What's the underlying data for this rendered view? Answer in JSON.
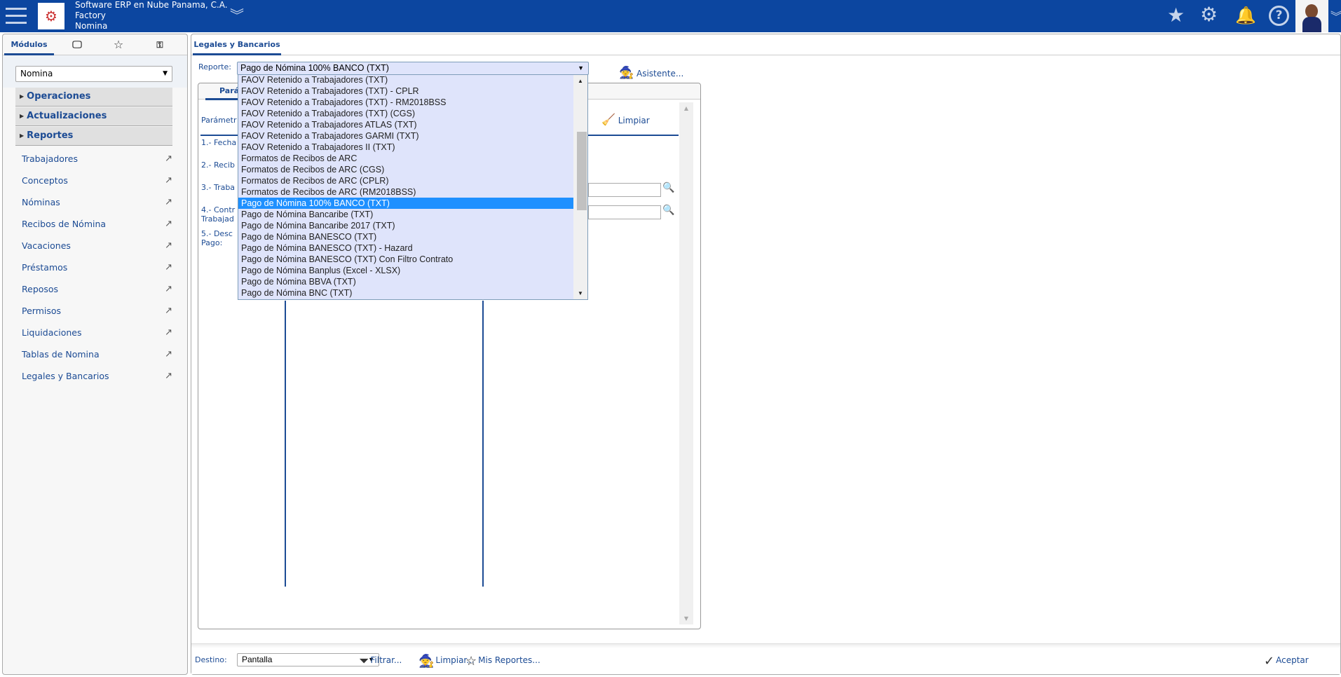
{
  "header": {
    "company": "Software ERP en Nube Panama, C.A.",
    "subtitle": "Factory",
    "module": "Nomina"
  },
  "sidebar": {
    "tabs": [
      {
        "label": "Módulos"
      },
      {
        "icon": "monitor-icon"
      },
      {
        "icon": "star-icon"
      },
      {
        "icon": "key-icon"
      }
    ],
    "module_select": "Nomina",
    "sections": [
      "Operaciones",
      "Actualizaciones",
      "Reportes"
    ],
    "links": [
      "Trabajadores",
      "Conceptos",
      "Nóminas",
      "Recibos de Nómina",
      "Vacaciones",
      "Préstamos",
      "Reposos",
      "Permisos",
      "Liquidaciones",
      "Tablas de Nomina",
      "Legales y Bancarios"
    ]
  },
  "main": {
    "tab": "Legales y Bancarios",
    "report_label": "Reporte:",
    "report_value": "Pago de Nómina 100% BANCO (TXT)",
    "wizard": "Asistente...",
    "inner_tab": "Pará",
    "params_heading": "Parámetr",
    "clear": "Limpiar",
    "params": [
      "1.- Fecha",
      "2.- Recib",
      "3.- Traba",
      "4.- Contr",
      "Trabajad",
      "5.- Desc",
      "Pago:"
    ],
    "options": [
      "FAOV Retenido a Trabajadores (TXT)",
      "FAOV Retenido a Trabajadores (TXT) - CPLR",
      "FAOV Retenido a Trabajadores (TXT) - RM2018BSS",
      "FAOV Retenido a Trabajadores (TXT) (CGS)",
      "FAOV Retenido a Trabajadores ATLAS (TXT)",
      "FAOV Retenido a Trabajadores GARMI (TXT)",
      "FAOV Retenido a Trabajadores II (TXT)",
      "Formatos de Recibos de ARC",
      "Formatos de Recibos de ARC (CGS)",
      "Formatos de Recibos de ARC (CPLR)",
      "Formatos de Recibos de ARC (RM2018BSS)",
      "Pago de Nómina 100% BANCO (TXT)",
      "Pago de Nómina Bancaribe (TXT)",
      "Pago de Nómina Bancaribe 2017 (TXT)",
      "Pago de Nómina BANESCO (TXT)",
      "Pago de Nómina BANESCO (TXT) - Hazard",
      "Pago de Nómina BANESCO (TXT) Con Filtro Contrato",
      "Pago de Nómina Banplus (Excel - XLSX)",
      "Pago de Nómina BBVA (TXT)",
      "Pago de Nómina BNC (TXT)"
    ],
    "selected_index": 11
  },
  "bottom": {
    "dest_label": "Destino:",
    "dest_value": "Pantalla",
    "filter": "Filtrar...",
    "clear": "Limpiar...",
    "my_reports": "Mis Reportes...",
    "accept": "Aceptar"
  },
  "colors": {
    "header": "#0c46a0",
    "accent": "#1c4b94",
    "selected": "#1e90ff",
    "list_bg": "#dfe4fb"
  }
}
